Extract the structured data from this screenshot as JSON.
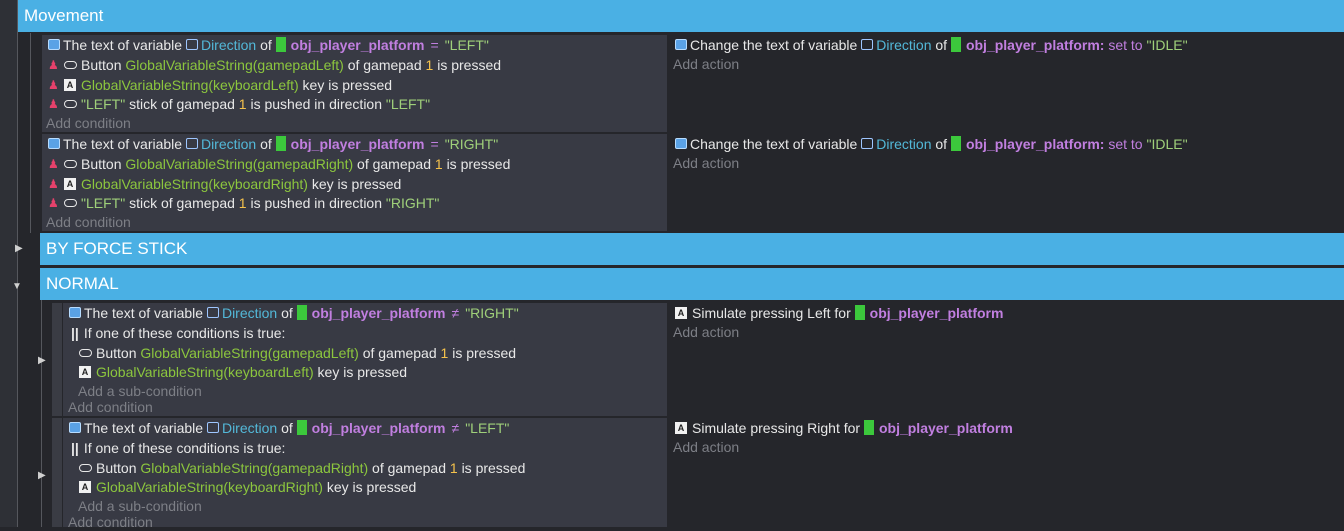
{
  "groups": {
    "movement": "Movement",
    "by_force_stick": "BY FORCE STICK",
    "normal": "NORMAL"
  },
  "common": {
    "the_text_of_variable": "The text of variable",
    "direction": "Direction",
    "of": "of",
    "obj": "obj_player_platform",
    "eq": "=",
    "neq": "≠",
    "button": "Button",
    "of_gamepad": "of gamepad",
    "gamepad_num": "1",
    "is_pressed": "is pressed",
    "key_is_pressed": "key is pressed",
    "stick_of_gamepad": "stick of gamepad",
    "pushed_in_direction": "is pushed in direction",
    "left_q": "\"LEFT\"",
    "add_condition": "Add condition",
    "add_action": "Add action",
    "add_sub_condition": "Add a sub-condition",
    "if_one_true": "If one of these conditions is true:",
    "change_text_of_variable": "Change the text of variable",
    "set_to": "set to",
    "idle_q": "\"IDLE\"",
    "simulate_left": "Simulate pressing Left for",
    "simulate_right": "Simulate pressing Right for"
  },
  "event1": {
    "value": "\"LEFT\"",
    "gp_var": "GlobalVariableString(gamepadLeft)",
    "kb_var": "GlobalVariableString(keyboardLeft)",
    "dir_value": "\"LEFT\""
  },
  "event2": {
    "value": "\"RIGHT\"",
    "gp_var": "GlobalVariableString(gamepadRight)",
    "kb_var": "GlobalVariableString(keyboardRight)",
    "dir_value": "\"RIGHT\""
  },
  "event3": {
    "value": "\"RIGHT\"",
    "gp_var": "GlobalVariableString(gamepadLeft)",
    "kb_var": "GlobalVariableString(keyboardLeft)"
  },
  "event4": {
    "value": "\"LEFT\"",
    "gp_var": "GlobalVariableString(gamepadRight)",
    "kb_var": "GlobalVariableString(keyboardRight)"
  },
  "icons": [
    "variable-icon",
    "scene-variable-icon",
    "object-icon",
    "gamepad-icon",
    "keyboard-icon",
    "inverted-condition-icon",
    "or-icon"
  ],
  "colors": {
    "group_header": "#4ab0e4",
    "condition_panel": "#383a44",
    "background": "#25262b",
    "parameter": "#8cc63e",
    "variable": "#53b8d8",
    "object": "#c17fe0",
    "number": "#f5c24c"
  }
}
